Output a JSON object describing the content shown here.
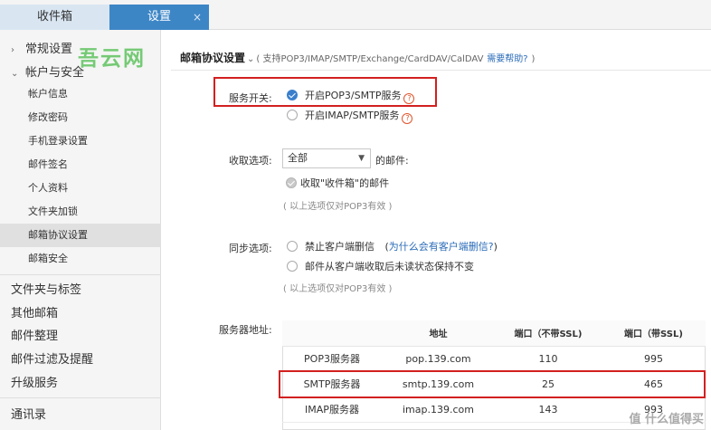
{
  "tabs": {
    "inbox": "收件箱",
    "settings": "设置",
    "close": "×"
  },
  "sidebar": {
    "watermark": "吾云网",
    "groups": [
      {
        "label": "常规设置",
        "arrow": "›"
      },
      {
        "label": "帐户与安全",
        "arrow": "⌄"
      }
    ],
    "items": [
      {
        "label": "帐户信息"
      },
      {
        "label": "修改密码"
      },
      {
        "label": "手机登录设置"
      },
      {
        "label": "邮件签名"
      },
      {
        "label": "个人资料"
      },
      {
        "label": "文件夹加锁"
      },
      {
        "label": "邮箱协议设置",
        "active": true
      },
      {
        "label": "邮箱安全"
      }
    ],
    "top_items": [
      {
        "label": "文件夹与标签"
      },
      {
        "label": "其他邮箱"
      },
      {
        "label": "邮件整理"
      },
      {
        "label": "邮件过滤及提醒"
      },
      {
        "label": "升级服务"
      },
      {
        "label": "通讯录"
      }
    ]
  },
  "main": {
    "title": "邮箱协议设置",
    "title_caret": "⌄",
    "subtitle": "( 支持POP3/IMAP/SMTP/Exchange/CardDAV/CalDAV",
    "help_link": "需要帮助?",
    "subtitle_end": ")",
    "service": {
      "label": "服务开关:",
      "pop3": "开启POP3/SMTP服务",
      "imap": "开启IMAP/SMTP服务",
      "pop3_checked": true,
      "imap_checked": false
    },
    "receive": {
      "label": "收取选项:",
      "select_value": "全部",
      "suffix": "的邮件:",
      "check_label": "收取\"收件箱\"的邮件",
      "note": "( 以上选项仅对POP3有效 )"
    },
    "sync": {
      "label": "同步选项:",
      "opt1": "禁止客户端删信",
      "opt1_link": "为什么会有客户端删信?",
      "opt1_paren_open": "(",
      "opt1_paren_close": ")",
      "opt2": "邮件从客户端收取后未读状态保持不变",
      "note": "( 以上选项仅对POP3有效 )"
    },
    "server": {
      "label": "服务器地址:",
      "headers": [
        "",
        "地址",
        "端口（不带SSL)",
        "端口（带SSL)"
      ],
      "rows": [
        [
          "POP3服务器",
          "pop.139.com",
          "110",
          "995"
        ],
        [
          "SMTP服务器",
          "smtp.139.com",
          "25",
          "465"
        ],
        [
          "IMAP服务器",
          "imap.139.com",
          "143",
          "993"
        ]
      ]
    },
    "corner_watermark": "值 什么值得买"
  },
  "colors": {
    "accent": "#3d86c6",
    "highlight_red": "#d32020",
    "link": "#2a6bb8"
  }
}
